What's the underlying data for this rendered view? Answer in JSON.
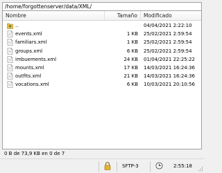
{
  "path": "/home/forgottenserver/data/XML/",
  "columns": {
    "name": "Nombre",
    "size": "Tamaño",
    "modified": "Modificado"
  },
  "files": [
    {
      "name": "..",
      "size": "",
      "modified": "04/04/2021 2:22:10",
      "type": "folder-up"
    },
    {
      "name": "events.xml",
      "size": "1 KB",
      "modified": "25/02/2021 2:59:54",
      "type": "file"
    },
    {
      "name": "familiars.xml",
      "size": "1 KB",
      "modified": "25/02/2021 2:59:54",
      "type": "file"
    },
    {
      "name": "groups.xml",
      "size": "6 KB",
      "modified": "25/02/2021 2:59:54",
      "type": "file"
    },
    {
      "name": "imbuements.xml",
      "size": "24 KB",
      "modified": "01/04/2021 22:25:22",
      "type": "file"
    },
    {
      "name": "mounts.xml",
      "size": "17 KB",
      "modified": "14/03/2021 16:24:36",
      "type": "file"
    },
    {
      "name": "outfits.xml",
      "size": "21 KB",
      "modified": "14/03/2021 16:24:36",
      "type": "file"
    },
    {
      "name": "vocations.xml",
      "size": "6 KB",
      "modified": "10/03/2021 20:10:56",
      "type": "file"
    }
  ],
  "selection_status": "0 B de 73,9 KB en 0 de 7",
  "statusbar": {
    "protocol": "SFTP-3",
    "elapsed": "2:55:18",
    "lock_icon": "lock-icon",
    "clock_icon": "clock-icon"
  },
  "colors": {
    "folder": "#e8b84a",
    "lock": "#d4a017"
  }
}
